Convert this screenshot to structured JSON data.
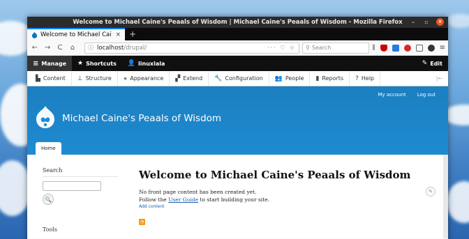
{
  "window": {
    "title": "Welcome to Michael Caine's Peaals of Wisdom | Michael Caine's Peaals of Wisdom - Mozilla Firefox",
    "minimize": "–",
    "maximize": "▫",
    "close": "×"
  },
  "tab": {
    "title": "Welcome to Michael Cai",
    "close": "×",
    "new_tab": "+"
  },
  "nav": {
    "back": "←",
    "forward": "→",
    "reload": "C",
    "home": "⌂",
    "url_host": "localhost",
    "url_path": "/drupal/",
    "url_actions": "··· ♡ ☆",
    "search_placeholder": "Search"
  },
  "admin_bar": {
    "manage": "Manage",
    "shortcuts": "Shortcuts",
    "user": "linuxlala",
    "edit": "Edit"
  },
  "tray": {
    "items": [
      "Content",
      "Structure",
      "Appearance",
      "Extend",
      "Configuration",
      "People",
      "Reports",
      "Help"
    ],
    "end_icon": "|←"
  },
  "site": {
    "my_account": "My account",
    "log_out": "Log out",
    "site_name": "Michael Caine's Peaals of Wisdom",
    "home_tab": "Home"
  },
  "sidebar": {
    "search_title": "Search",
    "search_button": "🔍",
    "tools_title": "Tools"
  },
  "main": {
    "page_title": "Welcome to Michael Caine's Peaals of Wisdom",
    "line1": "No front page content has been created yet.",
    "line2_pre": "Follow the ",
    "line2_link": "User Guide",
    "line2_post": " to start building your site.",
    "add_content": "Add content"
  },
  "colors": {
    "header_blue": "#1e8bd2",
    "admin_bar": "#0f0f0f",
    "tab_accent": "#0a84ff",
    "close_button": "#e95420",
    "rss": "#f39c12"
  }
}
